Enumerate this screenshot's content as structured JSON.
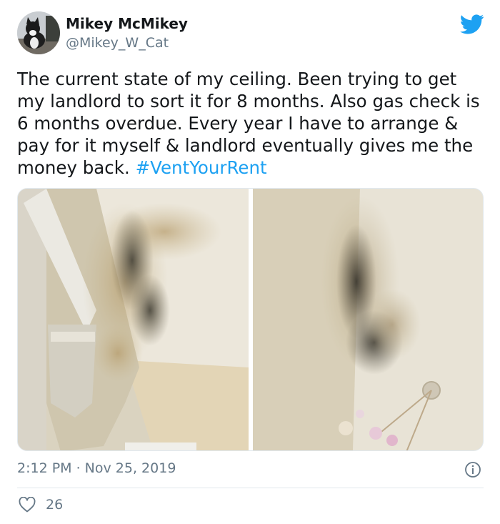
{
  "user": {
    "display_name": "Mikey McMikey",
    "handle": "@Mikey_W_Cat",
    "avatar_icon": "cat-avatar"
  },
  "brand": {
    "icon": "twitter-bird-icon",
    "color": "#1da1f2"
  },
  "tweet": {
    "text": "The current state of my ceiling. Been trying to get my landlord to sort it for 8 months. Also gas check is 6 months overdue. Every year I have to arrange & pay for it myself & landlord eventually gives me the money back.",
    "hashtag": "#VentYourRent",
    "media": [
      {
        "icon": "mouldy-ceiling-corner-photo"
      },
      {
        "icon": "mouldy-ceiling-light-fixture-photo"
      }
    ]
  },
  "meta": {
    "timestamp": "2:12 PM · Nov 25, 2019",
    "info_icon": "info-icon"
  },
  "actions": {
    "like_icon": "heart-icon",
    "like_count": "26"
  },
  "colors": {
    "text_primary": "#14171a",
    "text_secondary": "#657786",
    "divider": "#e1e8ed"
  }
}
